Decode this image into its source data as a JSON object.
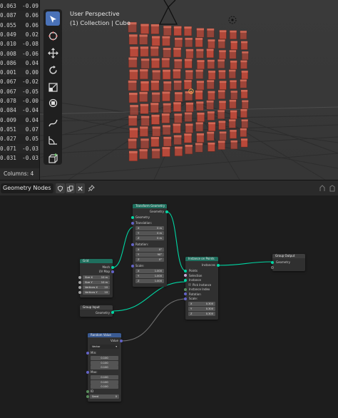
{
  "spreadsheet": {
    "rows": [
      [
        "0.063",
        "-0.09"
      ],
      [
        "0.087",
        "0.06"
      ],
      [
        "0.055",
        "0.06"
      ],
      [
        "0.049",
        "0.02"
      ],
      [
        "0.010",
        "-0.08"
      ],
      [
        "0.008",
        "-0.06"
      ],
      [
        "0.086",
        "0.04"
      ],
      [
        "0.001",
        "0.00"
      ],
      [
        "0.067",
        "-0.02"
      ],
      [
        "0.067",
        "-0.05"
      ],
      [
        "0.078",
        "-0.00"
      ],
      [
        "0.084",
        "-0.04"
      ],
      [
        "0.009",
        "0.04"
      ],
      [
        "0.051",
        "0.07"
      ],
      [
        "0.027",
        "0.05"
      ],
      [
        "0.071",
        "-0.03"
      ],
      [
        "0.031",
        "-0.03"
      ]
    ],
    "footer": "Columns: 4"
  },
  "viewport": {
    "title": "User Perspective",
    "subtitle": "(1) Collection | Cube",
    "tools": [
      "select-box-icon",
      "cursor-icon",
      "move-icon",
      "rotate-icon",
      "scale-icon",
      "transform-icon",
      "annotate-icon",
      "measure-icon",
      "add-cube-icon"
    ],
    "cube_color": "#b8493a"
  },
  "node_editor": {
    "editor_name": "Geometry Nodes",
    "nodes": {
      "transform": {
        "title": "Transform Geometry",
        "out": "Geometry",
        "in_geo": "Geometry",
        "translation": "Translation:",
        "t": [
          [
            "X",
            "0 m"
          ],
          [
            "Y",
            "0 m"
          ],
          [
            "Z",
            "0 m"
          ]
        ],
        "rotation": "Rotation:",
        "r": [
          [
            "X",
            "0°"
          ],
          [
            "Y",
            "90°"
          ],
          [
            "Z",
            "0°"
          ]
        ],
        "scale": "Scale:",
        "s": [
          [
            "X",
            "1.000"
          ],
          [
            "Y",
            "1.000"
          ],
          [
            "Z",
            "1.000"
          ]
        ]
      },
      "grid": {
        "title": "Grid",
        "out_mesh": "Mesh",
        "out_uv": "UV Map",
        "fields": [
          [
            "Size X",
            "10 m"
          ],
          [
            "Size Y",
            "10 m"
          ],
          [
            "Vertices X",
            "10"
          ],
          [
            "Vertices Y",
            "10"
          ]
        ]
      },
      "instance": {
        "title": "Instance on Points",
        "out": "Instances",
        "inputs": [
          "Points",
          "Selection",
          "Instance",
          "Pick Instance",
          "Instance Index",
          "Rotation",
          "Scale:"
        ],
        "scale": [
          [
            "X",
            "0.300"
          ],
          [
            "Y",
            "0.300"
          ],
          [
            "Z",
            "0.300"
          ]
        ]
      },
      "output": {
        "title": "Group Output",
        "in": "Geometry"
      },
      "input": {
        "title": "Group Input",
        "out": "Geometry"
      },
      "random": {
        "title": "Random Value",
        "out": "Value",
        "type": "Vector",
        "min_label": "Min:",
        "min": [
          "0.100",
          "0.100",
          "0.100"
        ],
        "max_label": "Max:",
        "max": [
          "0.100",
          "0.100",
          "0.100"
        ],
        "id_label": "ID",
        "seed": [
          "Seed",
          "0"
        ]
      }
    }
  }
}
